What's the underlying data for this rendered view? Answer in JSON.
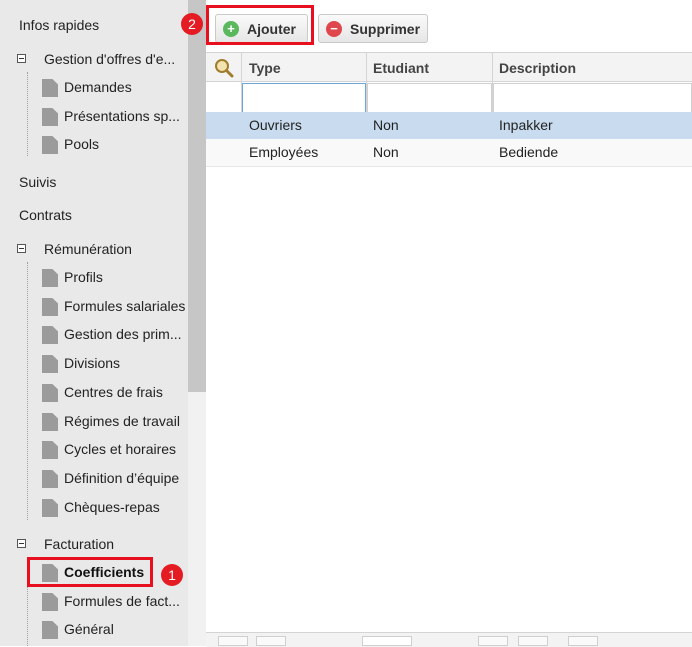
{
  "sidebar": {
    "infos_rapides": "Infos rapides",
    "gestion_offres": {
      "label": "Gestion d'offres d'e...",
      "items": [
        "Demandes",
        "Présentations sp...",
        "Pools"
      ]
    },
    "suivis": "Suivis",
    "contrats": "Contrats",
    "remuneration": {
      "label": "Rémunération",
      "items": [
        "Profils",
        "Formules salariales",
        "Gestion des prim...",
        "Divisions",
        "Centres de frais",
        "Régimes de travail",
        "Cycles et horaires",
        "Définition d’équipe",
        "Chèques-repas"
      ]
    },
    "facturation": {
      "label": "Facturation",
      "items": [
        "Coefficients",
        "Formules de fact...",
        "Général"
      ]
    }
  },
  "badges": {
    "first": "1",
    "second": "2"
  },
  "toolbar": {
    "add_label": "Ajouter",
    "add_icon": "plus-circle-icon",
    "delete_label": "Supprimer",
    "delete_icon": "minus-circle-icon"
  },
  "grid": {
    "columns": [
      "Type",
      "Etudiant",
      "Description"
    ],
    "filters": {
      "type": "",
      "etudiant": "",
      "description": ""
    },
    "rows": [
      {
        "type": "Ouvriers",
        "etudiant": "Non",
        "description": "Inpakker"
      },
      {
        "type": "Employées",
        "etudiant": "Non",
        "description": "Bediende"
      }
    ]
  },
  "colors": {
    "highlight": "#e8101e",
    "selected_row": "#c9dcef",
    "add_icon": "#5cb85c",
    "delete_icon": "#e0474c"
  }
}
